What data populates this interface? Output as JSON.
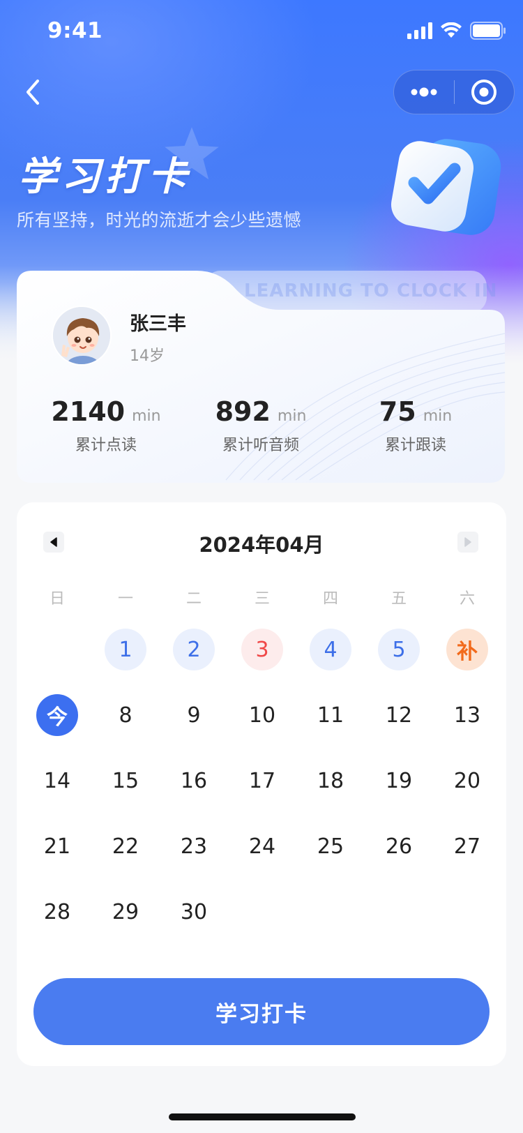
{
  "status_bar": {
    "time": "9:41"
  },
  "header": {
    "title": "学习打卡",
    "subtitle": "所有坚持，时光的流逝才会少些遗憾"
  },
  "profile": {
    "watermark": "LEARNING TO CLOCK IN",
    "name": "张三丰",
    "age": "14岁",
    "stats": [
      {
        "value": "2140",
        "unit": "min",
        "label": "累计点读"
      },
      {
        "value": "892",
        "unit": "min",
        "label": "累计听音频"
      },
      {
        "value": "75",
        "unit": "min",
        "label": "累计跟读"
      }
    ]
  },
  "calendar": {
    "month_label": "2024年04月",
    "weekdays": [
      "日",
      "一",
      "二",
      "三",
      "四",
      "五",
      "六"
    ],
    "rows": [
      [
        {
          "label": "",
          "state": "empty"
        },
        {
          "label": "1",
          "state": "checked"
        },
        {
          "label": "2",
          "state": "checked"
        },
        {
          "label": "3",
          "state": "missed"
        },
        {
          "label": "4",
          "state": "checked"
        },
        {
          "label": "5",
          "state": "checked"
        },
        {
          "label": "补",
          "state": "makeup"
        }
      ],
      [
        {
          "label": "今",
          "state": "today"
        },
        {
          "label": "8",
          "state": "normal"
        },
        {
          "label": "9",
          "state": "normal"
        },
        {
          "label": "10",
          "state": "normal"
        },
        {
          "label": "11",
          "state": "normal"
        },
        {
          "label": "12",
          "state": "normal"
        },
        {
          "label": "13",
          "state": "normal"
        }
      ],
      [
        {
          "label": "14",
          "state": "normal"
        },
        {
          "label": "15",
          "state": "normal"
        },
        {
          "label": "16",
          "state": "normal"
        },
        {
          "label": "17",
          "state": "normal"
        },
        {
          "label": "18",
          "state": "normal"
        },
        {
          "label": "19",
          "state": "normal"
        },
        {
          "label": "20",
          "state": "normal"
        }
      ],
      [
        {
          "label": "21",
          "state": "normal"
        },
        {
          "label": "22",
          "state": "normal"
        },
        {
          "label": "23",
          "state": "normal"
        },
        {
          "label": "24",
          "state": "normal"
        },
        {
          "label": "25",
          "state": "normal"
        },
        {
          "label": "26",
          "state": "normal"
        },
        {
          "label": "27",
          "state": "normal"
        }
      ],
      [
        {
          "label": "28",
          "state": "normal"
        },
        {
          "label": "29",
          "state": "normal"
        },
        {
          "label": "30",
          "state": "normal"
        },
        {
          "label": "",
          "state": "empty"
        },
        {
          "label": "",
          "state": "empty"
        },
        {
          "label": "",
          "state": "empty"
        },
        {
          "label": "",
          "state": "empty"
        }
      ]
    ]
  },
  "checkin_button": {
    "label": "学习打卡"
  },
  "colors": {
    "primary": "#4a7cf0",
    "today": "#3c6ff0",
    "checked_bg": "#eaf0fd",
    "missed": "#f04848",
    "makeup": "#f26a1b"
  },
  "icons": {
    "back": "chevron-left-icon",
    "more": "more-dots-icon",
    "close": "target-circle-icon",
    "badge": "checkmark-badge-icon",
    "prev": "triangle-left-icon",
    "next": "triangle-right-icon"
  }
}
